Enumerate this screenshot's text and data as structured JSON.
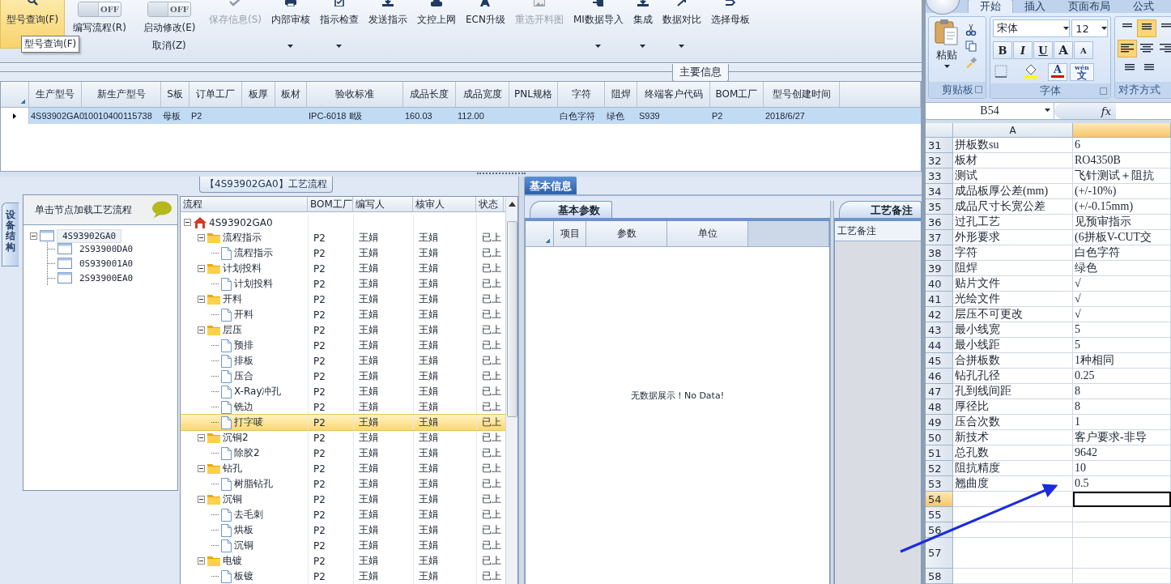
{
  "toolbar": {
    "items": [
      {
        "kind": "button",
        "label": "型号查询(F)",
        "selected": true,
        "disabled": false,
        "dropdown": false
      },
      {
        "kind": "toggle",
        "on": false,
        "state_text": "OFF",
        "labels": [
          "编写流程(R)"
        ]
      },
      {
        "kind": "toggle",
        "on": false,
        "state_text": "OFF",
        "labels": [
          "启动修改(E)",
          "取消(Z)"
        ]
      },
      {
        "kind": "button",
        "label": "保存信息(S)",
        "selected": false,
        "disabled": true,
        "dropdown": false
      },
      {
        "kind": "button",
        "label": "内部审核",
        "selected": false,
        "disabled": false,
        "dropdown": true
      },
      {
        "kind": "button",
        "label": "指示检查",
        "selected": false,
        "disabled": false,
        "dropdown": true
      },
      {
        "kind": "button",
        "label": "发送指示",
        "selected": false,
        "disabled": false,
        "dropdown": false
      },
      {
        "kind": "button",
        "label": "文控上网",
        "selected": false,
        "disabled": false,
        "dropdown": false
      },
      {
        "kind": "button",
        "label": "ECN升级",
        "selected": false,
        "disabled": false,
        "dropdown": false
      },
      {
        "kind": "button",
        "label": "重选开料图",
        "selected": false,
        "disabled": true,
        "dropdown": false
      },
      {
        "kind": "button",
        "label": "MI数据导入",
        "selected": false,
        "disabled": false,
        "dropdown": true
      },
      {
        "kind": "button",
        "label": "集成",
        "selected": false,
        "disabled": false,
        "dropdown": true
      },
      {
        "kind": "button",
        "label": "数据对比",
        "selected": false,
        "disabled": false,
        "dropdown": true
      },
      {
        "kind": "button",
        "label": "选择母板",
        "selected": false,
        "disabled": false,
        "dropdown": false
      }
    ],
    "tooltip": "型号查询(F)"
  },
  "main_info": {
    "title": "主要信息",
    "columns": [
      "生产型号",
      "新生产型号",
      "S板",
      "订单工厂",
      "板厚",
      "板材",
      "验收标准",
      "成品长度",
      "成品宽度",
      "PNL规格",
      "字符",
      "阻焊",
      "终端客户代码",
      "BOM工厂",
      "型号创建时间"
    ],
    "rows": [
      {
        "selected": true,
        "cells": [
          "4S93902GA0",
          "10010400115738",
          "母板",
          "P2",
          null,
          null,
          "IPC-6018 Ⅱ级",
          "160.03",
          "112.00",
          null,
          "白色字符",
          "绿色",
          "S939",
          "P2",
          "2018/6/27"
        ]
      }
    ]
  },
  "device_panel": {
    "side_tab": "设备结构",
    "hint": "单击节点加载工艺流程",
    "tree": [
      {
        "name": "4S93902GA0",
        "selected": true,
        "expanded": true,
        "children": [
          {
            "name": "2S93900DA0",
            "selected": false
          },
          {
            "name": "0S939001A0",
            "selected": false
          },
          {
            "name": "2S93900EA0",
            "selected": false
          }
        ]
      }
    ]
  },
  "flow": {
    "title": "【4S93902GA0】工艺流程",
    "columns": [
      "流程",
      "BOM工厂",
      "编写人",
      "核审人",
      "状态"
    ],
    "tree": [
      {
        "name": "4S93902GA0",
        "selected": false,
        "expanded": true,
        "children": [
          {
            "name": "流程指示",
            "bom": "P2",
            "writer": "王娟",
            "reviewer": "王娟",
            "status": "已上",
            "selected": false,
            "expanded": true,
            "children": [
              {
                "name": "流程指示",
                "bom": "P2",
                "writer": "王娟",
                "reviewer": "王娟",
                "status": "已上",
                "selected": false
              }
            ]
          },
          {
            "name": "计划投料",
            "bom": "P2",
            "writer": "王娟",
            "reviewer": "王娟",
            "status": "已上",
            "selected": false,
            "expanded": true,
            "children": [
              {
                "name": "计划投料",
                "bom": "P2",
                "writer": "王娟",
                "reviewer": "王娟",
                "status": "已上",
                "selected": false
              }
            ]
          },
          {
            "name": "开料",
            "bom": "P2",
            "writer": "王娟",
            "reviewer": "王娟",
            "status": "已上",
            "selected": false,
            "expanded": true,
            "children": [
              {
                "name": "开料",
                "bom": "P2",
                "writer": "王娟",
                "reviewer": "王娟",
                "status": "已上",
                "selected": false
              }
            ]
          },
          {
            "name": "层压",
            "bom": "P2",
            "writer": "王娟",
            "reviewer": "王娟",
            "status": "已上",
            "selected": false,
            "expanded": true,
            "children": [
              {
                "name": "预排",
                "bom": "P2",
                "writer": "王娟",
                "reviewer": "王娟",
                "status": "已上",
                "selected": false
              },
              {
                "name": "排板",
                "bom": "P2",
                "writer": "王娟",
                "reviewer": "王娟",
                "status": "已上",
                "selected": false
              },
              {
                "name": "压合",
                "bom": "P2",
                "writer": "王娟",
                "reviewer": "王娟",
                "status": "已上",
                "selected": false
              },
              {
                "name": "X-Ray冲孔",
                "bom": "P2",
                "writer": "王娟",
                "reviewer": "王娟",
                "status": "已上",
                "selected": false
              },
              {
                "name": "铣边",
                "bom": "P2",
                "writer": "王娟",
                "reviewer": "王娟",
                "status": "已上",
                "selected": false
              },
              {
                "name": "打字唛",
                "bom": "P2",
                "writer": "王娟",
                "reviewer": "王娟",
                "status": "已上",
                "selected": true
              }
            ]
          },
          {
            "name": "沉铜2",
            "bom": "P2",
            "writer": "王娟",
            "reviewer": "王娟",
            "status": "已上",
            "selected": false,
            "expanded": true,
            "children": [
              {
                "name": "除胶2",
                "bom": "P2",
                "writer": "王娟",
                "reviewer": "王娟",
                "status": "已上",
                "selected": false
              }
            ]
          },
          {
            "name": "钻孔",
            "bom": "P2",
            "writer": "王娟",
            "reviewer": "王娟",
            "status": "已上",
            "selected": false,
            "expanded": true,
            "children": [
              {
                "name": "树脂钻孔",
                "bom": "P2",
                "writer": "王娟",
                "reviewer": "王娟",
                "status": "已上",
                "selected": false
              }
            ]
          },
          {
            "name": "沉铜",
            "bom": "P2",
            "writer": "王娟",
            "reviewer": "王娟",
            "status": "已上",
            "selected": false,
            "expanded": true,
            "children": [
              {
                "name": "去毛刺",
                "bom": "P2",
                "writer": "王娟",
                "reviewer": "王娟",
                "status": "已上",
                "selected": false
              },
              {
                "name": "烘板",
                "bom": "P2",
                "writer": "王娟",
                "reviewer": "王娟",
                "status": "已上",
                "selected": false
              },
              {
                "name": "沉铜",
                "bom": "P2",
                "writer": "王娟",
                "reviewer": "王娟",
                "status": "已上",
                "selected": false
              }
            ]
          },
          {
            "name": "电镀",
            "bom": "P2",
            "writer": "王娟",
            "reviewer": "王娟",
            "status": "已上",
            "selected": false,
            "expanded": true,
            "children": [
              {
                "name": "板镀",
                "bom": "P2",
                "writer": "王娟",
                "reviewer": "王娟",
                "status": "已上",
                "selected": false
              }
            ]
          }
        ]
      }
    ]
  },
  "info": {
    "tab": "基本信息",
    "params_tab": "基本参数",
    "columns": [
      "项目",
      "参数",
      "单位"
    ],
    "empty_message": "无数据展示！No Data!",
    "notes_tab": "工艺备注",
    "notes_label": "工艺备注"
  },
  "excel": {
    "tabs": [
      {
        "label": "开始",
        "selected": true
      },
      {
        "label": "插入",
        "selected": false
      },
      {
        "label": "页面布局",
        "selected": false
      },
      {
        "label": "公式",
        "selected": false
      }
    ],
    "clipboard": {
      "paste": "粘贴",
      "group": "剪贴板"
    },
    "font": {
      "name": "宋体",
      "size": "12",
      "format_buttons": [
        "B",
        "I",
        "U",
        "A",
        "A"
      ],
      "font_color_label": "A",
      "phonetic": "文",
      "phonetic_top": "wén",
      "group": "字体"
    },
    "alignment": {
      "group": "对齐方式"
    },
    "name_box": "B54",
    "fx": "fx",
    "columns": [
      {
        "label": "A",
        "selected": false
      },
      {
        "selected": true
      }
    ],
    "rows": [
      {
        "num": "31",
        "a": "拼板数su",
        "b": "6",
        "selected": false
      },
      {
        "num": "32",
        "a": "板材",
        "b": "RO4350B",
        "selected": false
      },
      {
        "num": "33",
        "a": "测试",
        "b": "飞针测试＋阻抗",
        "selected": false
      },
      {
        "num": "34",
        "a": "成品板厚公差(mm)",
        "b": "(+/-10%)",
        "selected": false
      },
      {
        "num": "35",
        "a": "成品尺寸长宽公差",
        "b": "(+/-0.15mm)",
        "selected": false
      },
      {
        "num": "36",
        "a": "过孔工艺",
        "b": "见预审指示",
        "selected": false
      },
      {
        "num": "37",
        "a": "外形要求",
        "b": "(6拼板V-CUT交",
        "selected": false
      },
      {
        "num": "38",
        "a": "字符",
        "b": "白色字符",
        "selected": false
      },
      {
        "num": "39",
        "a": "阻焊",
        "b": "绿色",
        "selected": false
      },
      {
        "num": "40",
        "a": "贴片文件",
        "b": "√",
        "selected": false
      },
      {
        "num": "41",
        "a": "光绘文件",
        "b": "√",
        "selected": false
      },
      {
        "num": "42",
        "a": "层压不可更改",
        "b": "√",
        "selected": false
      },
      {
        "num": "43",
        "a": "最小线宽",
        "b": "5",
        "selected": false
      },
      {
        "num": "44",
        "a": "最小线距",
        "b": "5",
        "selected": false
      },
      {
        "num": "45",
        "a": "合拼板数",
        "b": "1种相同",
        "selected": false
      },
      {
        "num": "46",
        "a": "钻孔孔径",
        "b": "0.25",
        "selected": false
      },
      {
        "num": "47",
        "a": "孔到线间距",
        "b": "8",
        "selected": false
      },
      {
        "num": "48",
        "a": "厚径比",
        "b": "8",
        "selected": false
      },
      {
        "num": "49",
        "a": "压合次数",
        "b": "1",
        "selected": false
      },
      {
        "num": "50",
        "a": "新技术",
        "b": "客户要求-非导",
        "selected": false
      },
      {
        "num": "51",
        "a": "总孔数",
        "b": "9642",
        "selected": false
      },
      {
        "num": "52",
        "a": "阻抗精度",
        "b": "10",
        "selected": false
      },
      {
        "num": "53",
        "a": "翘曲度",
        "b": "0.5",
        "selected": false
      },
      {
        "num": "54",
        "selected": true
      },
      {
        "num": "55",
        "selected": false
      },
      {
        "num": "56",
        "selected": false
      },
      {
        "num": "57",
        "selected": false,
        "tall": true
      },
      {
        "num": "58",
        "selected": false
      }
    ]
  }
}
